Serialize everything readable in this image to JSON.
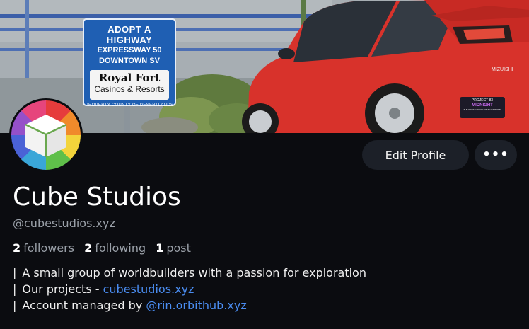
{
  "banner": {
    "sign": {
      "line1": "ADOPT A HIGHWAY",
      "line2": "EXPRESSWAY 50",
      "line3": "DOWNTOWN SV",
      "sponsor_name": "Royal Fort",
      "sponsor_sub": "Casinos & Resorts",
      "footer": "PROPERTY COUNTY OF DESERTLANDS"
    },
    "car": {
      "badge": "MIZUISHI",
      "plate_top": "PROJECT 83",
      "plate_mid": "MIDNIGHT",
      "plate_bottom": "THE WORLD IS YOURS TO EXPLORE"
    }
  },
  "actions": {
    "edit_label": "Edit Profile",
    "more_label": "•••"
  },
  "profile": {
    "name": "Cube Studios",
    "handle": "@cubestudios.xyz",
    "stats": {
      "followers_count": "2",
      "followers_label": "followers",
      "following_count": "2",
      "following_label": "following",
      "posts_count": "1",
      "posts_label": "post"
    },
    "bio": {
      "bar": "|",
      "line1": "A small group of worldbuilders with a passion for exploration",
      "line2_text": "Our projects - ",
      "line2_link": "cubestudios.xyz",
      "line3_text": "Account managed by ",
      "line3_link": "@rin.orbithub.xyz"
    }
  },
  "colors": {
    "background": "#0b0c10",
    "button_bg": "#1c2028",
    "link": "#4a8cf0",
    "muted_text": "#9aa0a8",
    "car_red": "#d8322b"
  }
}
